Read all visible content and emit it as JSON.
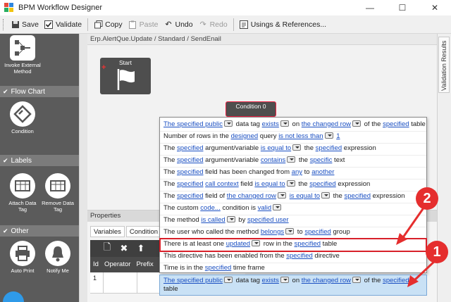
{
  "window": {
    "title": "BPM Workflow Designer",
    "minimize": "—",
    "maximize": "☐",
    "close": "✕"
  },
  "toolbar": {
    "save": "Save",
    "validate": "Validate",
    "copy": "Copy",
    "paste": "Paste",
    "undo": "Undo",
    "redo": "Redo",
    "usings": "Usings & References..."
  },
  "toolbox": {
    "invoke_external": "Invoke External Method",
    "section_flowchart": "Flow Chart",
    "condition": "Condition",
    "section_labels": "Labels",
    "attach_data_tag": "Attach Data Tag",
    "remove_data_tag": "Remove Data Tag",
    "section_other": "Other",
    "auto_print": "Auto Print",
    "notify_me": "Notify Me"
  },
  "design": {
    "breadcrumb": "Erp.AlertQue.Update / Standard / SendEnail",
    "start_node": "Start",
    "condition_node": "Condition 0"
  },
  "validation_tab": "Validation Results",
  "properties": {
    "header": "Properties",
    "tabs": [
      "Variables",
      "Condition 0"
    ],
    "columns": [
      "Id",
      "Operator",
      "Prefix"
    ],
    "row_id": "1"
  },
  "dropdown_items": [
    [
      "The specified public",
      "#",
      " data tag ",
      "exists",
      "#",
      " on ",
      "the changed row",
      "#",
      " of the ",
      "specified",
      " table"
    ],
    [
      "Number of rows in the ",
      "designed",
      " query ",
      "is not less than",
      "#",
      " ",
      "1"
    ],
    [
      "The ",
      "specified",
      " argument/variable ",
      "is equal to",
      "#",
      " the ",
      "specified",
      " expression"
    ],
    [
      "The ",
      "specified",
      " argument/variable ",
      "contains",
      "#",
      " the ",
      "specific",
      " text"
    ],
    [
      "The ",
      "specified",
      " field has been changed from ",
      "any",
      " to ",
      "another"
    ],
    [
      "The ",
      "specified",
      " ",
      "call context",
      " field ",
      "is equal to",
      "#",
      " the ",
      "specified",
      " expression"
    ],
    [
      "The ",
      "specified",
      " field of ",
      "the changed row",
      "#",
      " ",
      "is equal to",
      "#",
      " the ",
      "specified",
      " expression"
    ],
    [
      "The custom ",
      "code...",
      " condition is ",
      "valid",
      "#"
    ],
    [
      "The method ",
      "is called",
      "#",
      " by ",
      "specified user"
    ],
    [
      "The user who called the method ",
      "belongs",
      "#",
      " to ",
      "specified",
      " group"
    ],
    [
      "There is at least one ",
      "updated",
      "#",
      " row in the ",
      "specified",
      " table"
    ],
    [
      "This directive has been enabled from the ",
      "specified",
      " directive"
    ],
    [
      "Time is in the ",
      "specified",
      " time frame"
    ]
  ],
  "selected_condition": [
    "The specified public",
    "#",
    " data tag ",
    "exists",
    "#",
    " on ",
    "the changed row",
    "#",
    " of the ",
    "specified",
    " table"
  ],
  "callouts": [
    "2",
    "1"
  ],
  "colors": {
    "link": "#1a4fc2",
    "callout": "#e52e2e",
    "highlight": "#d8202a",
    "toolbox_bg": "#5b5b5b"
  }
}
